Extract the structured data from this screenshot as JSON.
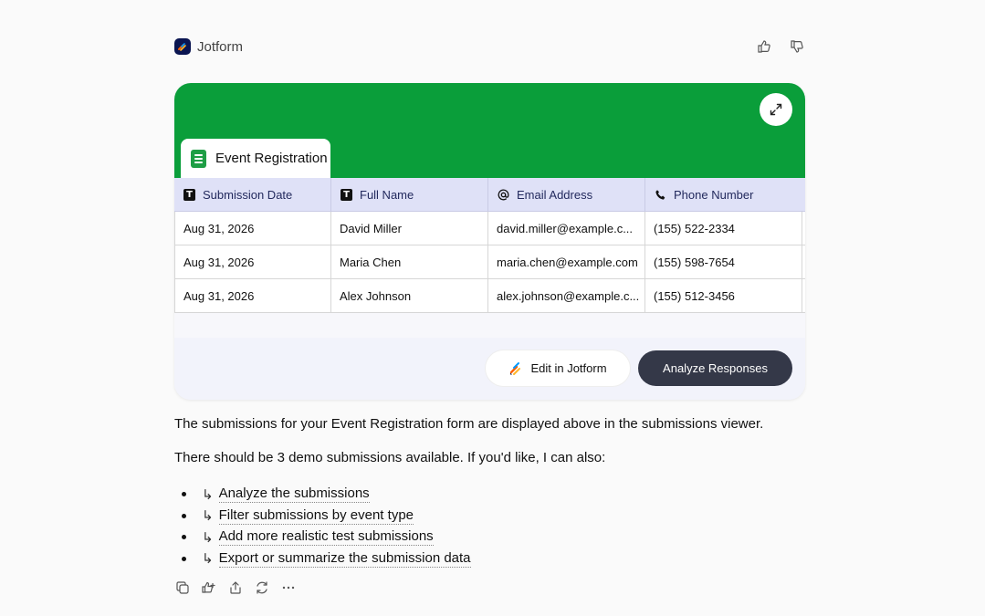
{
  "header": {
    "app_name": "Jotform"
  },
  "card": {
    "tab_title": "Event Registration",
    "columns": [
      {
        "icon": "text-type-icon",
        "label": "Submission Date"
      },
      {
        "icon": "text-type-icon",
        "label": "Full Name"
      },
      {
        "icon": "at-sign-icon",
        "label": "Email Address"
      },
      {
        "icon": "phone-icon",
        "label": "Phone Number"
      }
    ],
    "rows": [
      [
        "Aug 31, 2026",
        "David Miller",
        "david.miller@example.c...",
        "(155) 522-2334"
      ],
      [
        "Aug 31, 2026",
        "Maria Chen",
        "maria.chen@example.com",
        "(155) 598-7654"
      ],
      [
        "Aug 31, 2026",
        "Alex Johnson",
        "alex.johnson@example.c...",
        "(155) 512-3456"
      ]
    ],
    "edit_button": "Edit in Jotform",
    "analyze_button": "Analyze Responses"
  },
  "message": {
    "para1": "The submissions for your Event Registration form are displayed above in the submissions viewer.",
    "para2": "There should be 3 demo submissions available. If you'd like, I can also:",
    "suggestions": [
      "Analyze the submissions",
      "Filter submissions by event type",
      "Add more realistic test submissions",
      "Export or summarize the submission data"
    ]
  },
  "colors": {
    "banner": "#0a9e3a",
    "header_row": "#dfe1f7",
    "analyze_button": "#343848"
  }
}
